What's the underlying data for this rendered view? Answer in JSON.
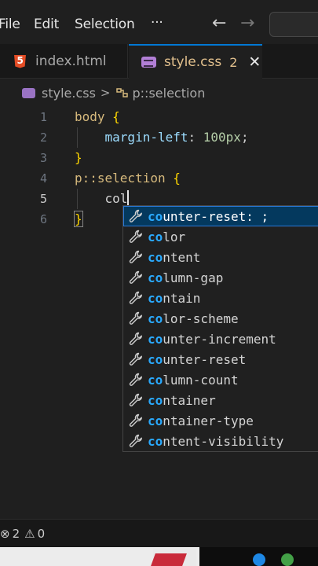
{
  "menu": {
    "items": [
      "File",
      "Edit",
      "Selection"
    ],
    "more": "···",
    "back_arrow": "←",
    "forward_arrow": "→"
  },
  "tabs": [
    {
      "label": "index.html",
      "icon": "html5-icon",
      "active": false
    },
    {
      "label": "style.css",
      "icon": "css-file-icon",
      "active": true,
      "badge": "2",
      "close": "✕"
    }
  ],
  "breadcrumb": {
    "file": "style.css",
    "separator": ">",
    "symbol": "p::selection"
  },
  "editor": {
    "lines": [
      {
        "num": "1",
        "tokens": [
          {
            "t": "body",
            "c": "t-sel"
          },
          {
            "t": " ",
            "c": "t-text"
          },
          {
            "t": "{",
            "c": "t-brace"
          }
        ]
      },
      {
        "num": "2",
        "tokens": [
          {
            "t": "    ",
            "c": "t-text"
          },
          {
            "t": "margin-left",
            "c": "t-prop"
          },
          {
            "t": ": ",
            "c": "t-punc"
          },
          {
            "t": "100px",
            "c": "t-num"
          },
          {
            "t": ";",
            "c": "t-punc"
          }
        ]
      },
      {
        "num": "3",
        "tokens": [
          {
            "t": "}",
            "c": "t-brace"
          }
        ]
      },
      {
        "num": "4",
        "tokens": [
          {
            "t": "p::selection",
            "c": "t-sel"
          },
          {
            "t": " ",
            "c": "t-text"
          },
          {
            "t": "{",
            "c": "t-brace"
          }
        ]
      },
      {
        "num": "5",
        "tokens": [
          {
            "t": "    ",
            "c": "t-text"
          },
          {
            "t": "col",
            "c": "t-text"
          }
        ],
        "active": true
      },
      {
        "num": "6",
        "tokens": [
          {
            "t": "}",
            "c": "t-brace"
          }
        ]
      }
    ]
  },
  "suggestions": {
    "typed": "co",
    "items": [
      {
        "match": "co",
        "rest": "unter-reset: ;",
        "selected": true
      },
      {
        "match": "co",
        "rest": "lor"
      },
      {
        "match": "co",
        "rest": "ntent"
      },
      {
        "match": "co",
        "rest": "lumn-gap"
      },
      {
        "match": "co",
        "rest": "ntain"
      },
      {
        "match": "co",
        "rest": "lor-scheme"
      },
      {
        "match": "co",
        "rest": "unter-increment"
      },
      {
        "match": "co",
        "rest": "unter-reset"
      },
      {
        "match": "co",
        "rest": "lumn-count"
      },
      {
        "match": "co",
        "rest": "ntainer"
      },
      {
        "match": "co",
        "rest": "ntainer-type"
      },
      {
        "match": "co",
        "rest": "ntent-visibility"
      }
    ],
    "item_icon": "wrench-icon"
  },
  "status": {
    "errors": "2",
    "warnings": "0",
    "error_icon": "⊗",
    "warning_icon": "⚠"
  },
  "colors": {
    "accent": "#0078d4",
    "modified_tab": "#e2c08d",
    "suggest_selected": "#04395e",
    "suggest_match": "#2aaaff"
  }
}
